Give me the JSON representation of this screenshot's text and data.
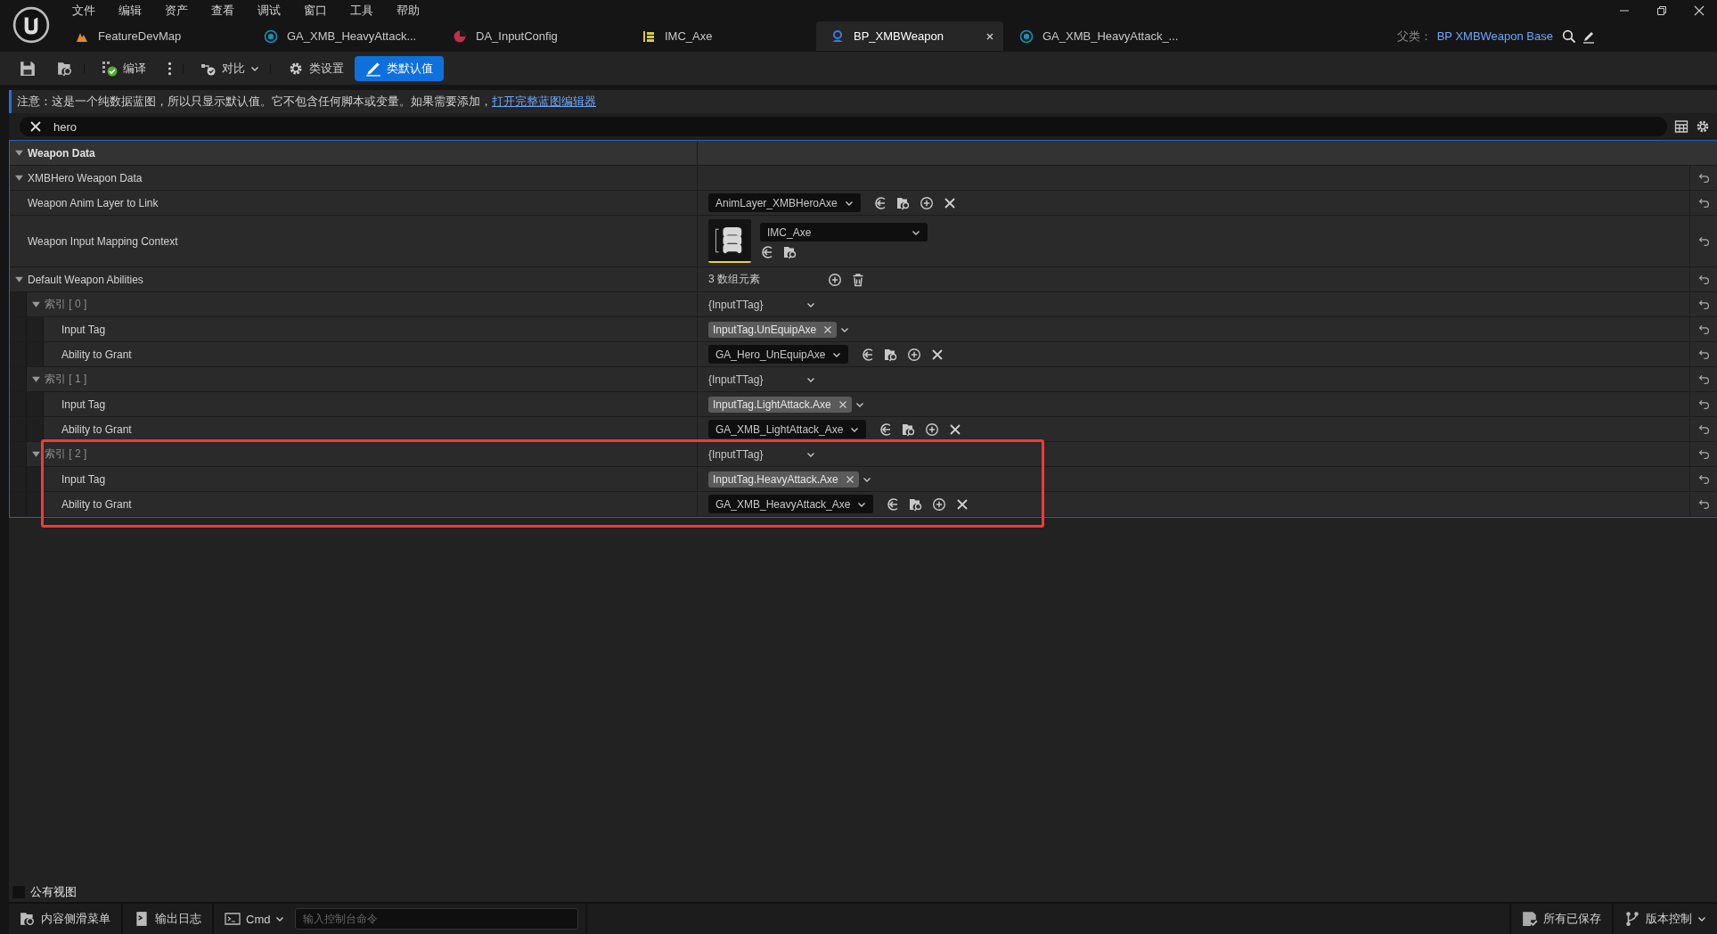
{
  "menu": [
    "文件",
    "编辑",
    "资产",
    "查看",
    "调试",
    "窗口",
    "工具",
    "帮助"
  ],
  "tabs": [
    {
      "label": "FeatureDevMap",
      "kind": "map",
      "selected": false,
      "closable": false
    },
    {
      "label": "GA_XMB_HeavyAttack...",
      "kind": "ability",
      "selected": false,
      "closable": false
    },
    {
      "label": "DA_InputConfig",
      "kind": "data",
      "selected": false,
      "closable": false
    },
    {
      "label": "IMC_Axe",
      "kind": "mapping",
      "selected": false,
      "closable": false
    },
    {
      "label": "BP_XMBWeapon",
      "kind": "blueprint",
      "selected": true,
      "closable": true
    },
    {
      "label": "GA_XMB_HeavyAttack_...",
      "kind": "ability",
      "selected": false,
      "closable": false
    }
  ],
  "parent_class": {
    "label": "父类：",
    "value": "BP XMBWeapon Base"
  },
  "toolbar": [
    {
      "kind": "save"
    },
    {
      "kind": "browse"
    },
    {
      "kind": "compile",
      "label": "编译"
    },
    {
      "kind": "more"
    },
    {
      "kind": "diff",
      "label": "对比"
    },
    {
      "kind": "settings",
      "label": "类设置"
    },
    {
      "kind": "defaults",
      "label": "类默认值",
      "selected": true
    }
  ],
  "notice": {
    "text": "注意：这是一个纯数据蓝图，所以只显示默认值。它不包含任何脚本或变量。如果需要添加，",
    "link": "打开完整蓝图编辑器"
  },
  "search": {
    "value": "hero"
  },
  "properties": [
    {
      "label": "Weapon Data",
      "kind": "category",
      "expanded": true,
      "children": [
        {
          "label": "XMBHero Weapon Data",
          "kind": "group",
          "expanded": true,
          "children": [
            {
              "label": "Weapon Anim Layer to Link",
              "kind": "asset",
              "value": "AnimLayer_XMBHeroAxe"
            },
            {
              "label": "Weapon Input Mapping Context",
              "kind": "thumb-asset",
              "value": "IMC_Axe"
            },
            {
              "label": "Default Weapon Abilities",
              "kind": "array",
              "expanded": true,
              "value": "3 数组元素",
              "children": [
                {
                  "label": "索引 [ 0 ]",
                  "kind": "struct",
                  "expanded": true,
                  "value": "{InputTTag}",
                  "children": [
                    {
                      "label": "Input Tag",
                      "kind": "tag",
                      "value": "InputTag.UnEquipAxe"
                    },
                    {
                      "label": "Ability to Grant",
                      "kind": "asset",
                      "value": "GA_Hero_UnEquipAxe"
                    }
                  ]
                },
                {
                  "label": "索引 [ 1 ]",
                  "kind": "struct",
                  "expanded": true,
                  "value": "{InputTTag}",
                  "children": [
                    {
                      "label": "Input Tag",
                      "kind": "tag",
                      "value": "InputTag.LightAttack.Axe"
                    },
                    {
                      "label": "Ability to Grant",
                      "kind": "asset",
                      "value": "GA_XMB_LightAttack_Axe"
                    }
                  ]
                },
                {
                  "label": "索引 [ 2 ]",
                  "kind": "struct",
                  "expanded": true,
                  "highlighted": true,
                  "value": "{InputTTag}",
                  "children": [
                    {
                      "label": "Input Tag",
                      "kind": "tag",
                      "value": "InputTag.HeavyAttack.Axe"
                    },
                    {
                      "label": "Ability to Grant",
                      "kind": "asset",
                      "value": "GA_XMB_HeavyAttack_Axe"
                    }
                  ]
                }
              ]
            }
          ]
        }
      ]
    }
  ],
  "public_view": {
    "label": "公有视图",
    "checked": false
  },
  "status_bar": {
    "left": [
      {
        "kind": "drawer",
        "label": "内容侧滑菜单"
      },
      {
        "kind": "log",
        "label": "输出日志"
      },
      {
        "kind": "cmd",
        "label": "Cmd"
      }
    ],
    "console_placeholder": "输入控制台命令",
    "right": [
      {
        "kind": "saved",
        "label": "所有已保存"
      },
      {
        "kind": "vcs",
        "label": "版本控制"
      }
    ]
  }
}
